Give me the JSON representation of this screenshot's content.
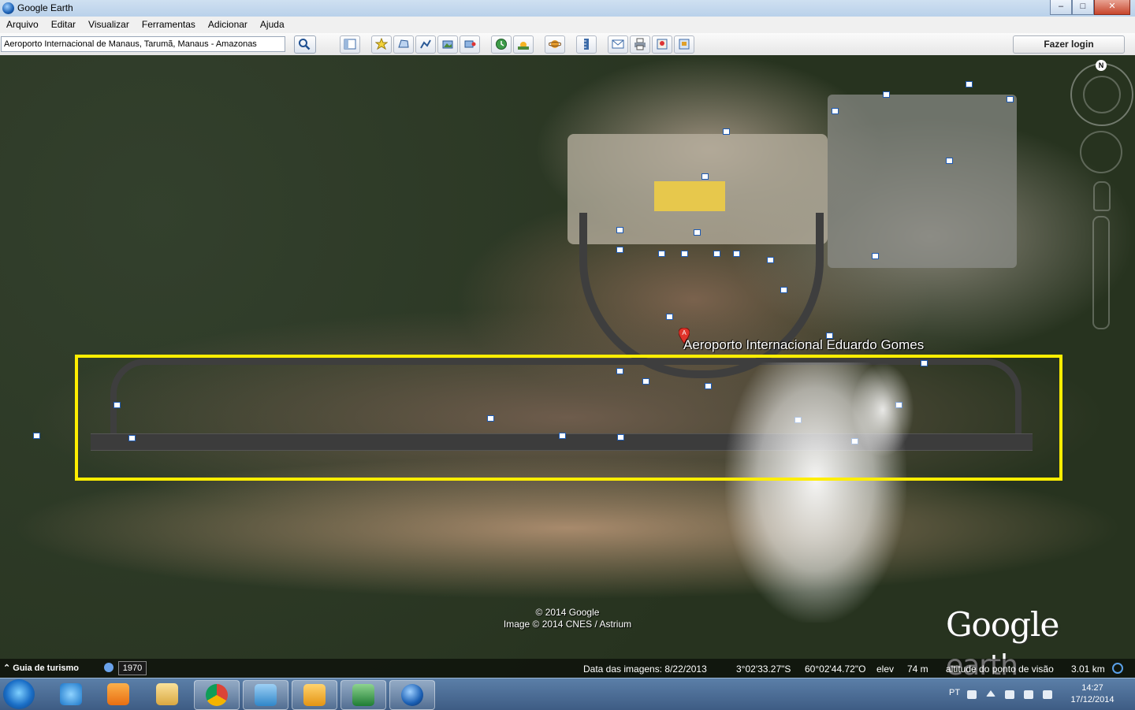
{
  "window": {
    "title": "Google Earth",
    "buttons": {
      "minimize": "–",
      "maximize": "□",
      "close": "✕"
    }
  },
  "menu": [
    "Arquivo",
    "Editar",
    "Visualizar",
    "Ferramentas",
    "Adicionar",
    "Ajuda"
  ],
  "toolbar": {
    "search_value": "Aeroporto Internacional de Manaus, Tarumã, Manaus - Amazonas",
    "login_label": "Fazer login",
    "buttons": [
      "sidebar",
      "placemark",
      "polygon",
      "path",
      "image-overlay",
      "record-tour",
      "historical-imagery",
      "sunlight",
      "planets",
      "ruler",
      "email",
      "print",
      "view-in-maps",
      "save-image"
    ]
  },
  "map": {
    "placemark_marker": "A",
    "placemark_label": "Aeroporto Internacional Eduardo Gomes",
    "copyright_line1": "© 2014 Google",
    "copyright_line2": "Image © 2014 CNES / Astrium",
    "logo_word1": "Google",
    "logo_word2": "earth",
    "north": "N",
    "highlight_color": "#ffee00"
  },
  "status": {
    "tour_label": "Guia de turismo",
    "year": "1970",
    "imagery_date": "Data das imagens: 8/22/2013",
    "latitude": "3°02'33.27\"S",
    "longitude": "60°02'44.72\"O",
    "elev_label": "elev",
    "elev_value": "74 m",
    "eye_label": "altitude do ponto de visão",
    "eye_value": "3.01 km"
  },
  "taskbar": {
    "apps": [
      "internet-explorer",
      "media-player",
      "file-explorer",
      "chrome",
      "lync",
      "outlook",
      "excel",
      "google-earth"
    ],
    "language": "PT",
    "time": "14:27",
    "date": "17/12/2014"
  }
}
